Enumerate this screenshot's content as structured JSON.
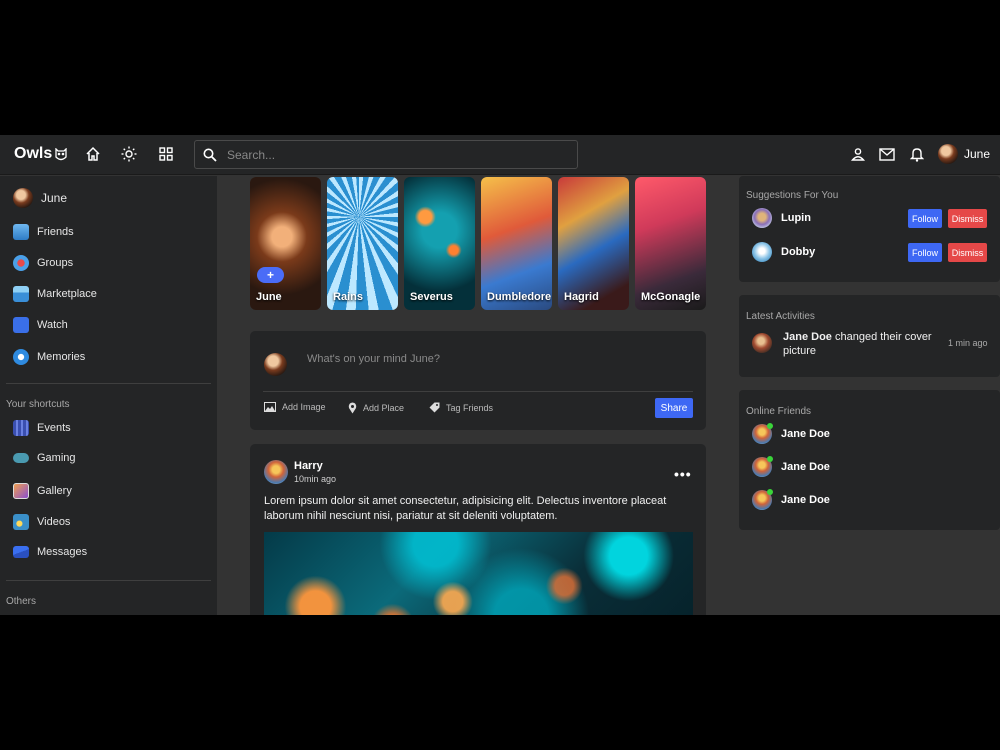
{
  "navbar": {
    "logo": "Owls",
    "search_placeholder": "Search...",
    "user_name": "June"
  },
  "sidebar": {
    "user": "June",
    "items": [
      {
        "label": "Friends",
        "icon": "friends-icon"
      },
      {
        "label": "Groups",
        "icon": "groups-icon"
      },
      {
        "label": "Marketplace",
        "icon": "marketplace-icon"
      },
      {
        "label": "Watch",
        "icon": "watch-icon"
      },
      {
        "label": "Memories",
        "icon": "memories-icon"
      }
    ],
    "shortcuts_heading": "Your shortcuts",
    "shortcuts": [
      {
        "label": "Events",
        "icon": "events-icon"
      },
      {
        "label": "Gaming",
        "icon": "gaming-icon"
      },
      {
        "label": "Gallery",
        "icon": "gallery-icon"
      },
      {
        "label": "Videos",
        "icon": "videos-icon"
      },
      {
        "label": "Messages",
        "icon": "messages-icon"
      }
    ],
    "others_heading": "Others"
  },
  "stories": [
    {
      "name": "June",
      "add": "+"
    },
    {
      "name": "Rains"
    },
    {
      "name": "Severus"
    },
    {
      "name": "Dumbledore"
    },
    {
      "name": "Hagrid"
    },
    {
      "name": "McGonagle"
    }
  ],
  "composer": {
    "placeholder": "What's on your mind June?",
    "add_image": "Add Image",
    "add_place": "Add Place",
    "tag_friends": "Tag Friends",
    "share": "Share"
  },
  "post": {
    "author": "Harry",
    "time": "10min ago",
    "more": "•••",
    "text": "Lorem ipsum dolor sit amet consectetur, adipisicing elit. Delectus inventore placeat laborum nihil nesciunt nisi, pariatur at sit deleniti voluptatem."
  },
  "suggestions": {
    "title": "Suggestions For You",
    "people": [
      {
        "name": "Lupin",
        "follow": "Follow",
        "dismiss": "Dismiss"
      },
      {
        "name": "Dobby",
        "follow": "Follow",
        "dismiss": "Dismiss"
      }
    ]
  },
  "activities": {
    "title": "Latest Activities",
    "item": {
      "name": "Jane Doe",
      "action": " changed their cover picture",
      "time": "1 min ago"
    }
  },
  "online": {
    "title": "Online Friends",
    "friends": [
      {
        "name": "Jane Doe"
      },
      {
        "name": "Jane Doe"
      },
      {
        "name": "Jane Doe"
      }
    ]
  },
  "colors": {
    "accent": "#3e68f4",
    "danger": "#e54848",
    "online": "#3ad43a",
    "panel": "#242526",
    "background": "#333333"
  }
}
